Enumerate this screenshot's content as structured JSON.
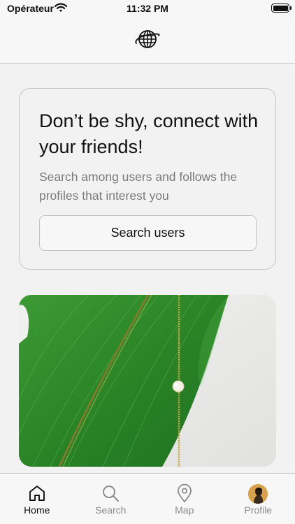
{
  "status_bar": {
    "carrier": "Opérateur",
    "time": "11:32 PM"
  },
  "header": {
    "logo_icon": "globe-icon"
  },
  "connect_card": {
    "title": "Don’t be shy, connect with your friends!",
    "subtitle": "Search among users and follows the profiles that interest you",
    "button_label": "Search users"
  },
  "feature_image": {
    "subject": "green leaf with gold chain"
  },
  "tab_bar": {
    "active": "home",
    "tabs": [
      {
        "label": "Home",
        "icon": "home-icon"
      },
      {
        "label": "Search",
        "icon": "search-icon"
      },
      {
        "label": "Map",
        "icon": "map-pin-icon"
      },
      {
        "label": "Profile",
        "icon": "avatar"
      }
    ]
  },
  "colors": {
    "background": "#f2f2f2",
    "text_primary": "#111111",
    "text_secondary": "#7b7b7b",
    "tab_inactive": "#8a8a8a",
    "border": "#c4c4c4",
    "leaf_green": "#2f8a2a"
  }
}
